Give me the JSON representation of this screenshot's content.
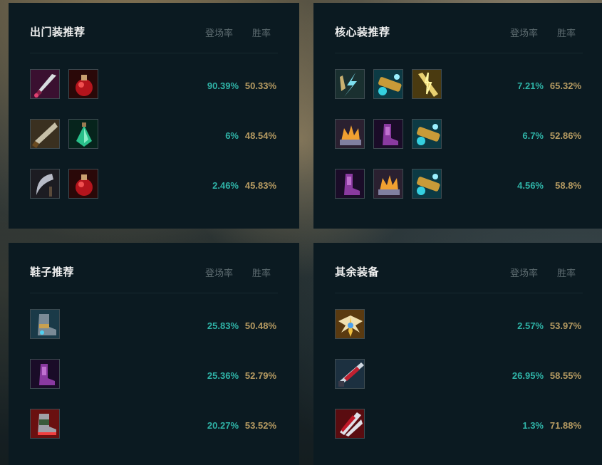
{
  "panels": [
    {
      "title": "出门装推荐",
      "col_rate": "登场率",
      "col_win": "胜率",
      "rows": [
        {
          "items": [
            "dagger-icon",
            "health-potion-icon"
          ],
          "rate": "90.39%",
          "win": "50.33%"
        },
        {
          "items": [
            "broadsword-icon",
            "refillable-potion-icon"
          ],
          "rate": "6%",
          "win": "48.54%"
        },
        {
          "items": [
            "sickle-icon",
            "health-potion-icon"
          ],
          "rate": "2.46%",
          "win": "45.83%"
        }
      ]
    },
    {
      "title": "核心装推荐",
      "col_rate": "登场率",
      "col_win": "胜率",
      "rows": [
        {
          "items": [
            "lightning-claw-icon",
            "cannon-icon",
            "zap-blade-icon"
          ],
          "rate": "7.21%",
          "win": "65.32%"
        },
        {
          "items": [
            "flame-crown-icon",
            "purple-boots-icon",
            "cannon-icon"
          ],
          "rate": "6.7%",
          "win": "52.86%"
        },
        {
          "items": [
            "purple-boots-icon",
            "flame-crown-icon",
            "cannon-icon"
          ],
          "rate": "4.56%",
          "win": "58.8%"
        }
      ]
    },
    {
      "title": "鞋子推荐",
      "col_rate": "登场率",
      "col_win": "胜率",
      "rows": [
        {
          "items": [
            "armored-boots-icon"
          ],
          "rate": "25.83%",
          "win": "50.48%"
        },
        {
          "items": [
            "purple-boots-icon"
          ],
          "rate": "25.36%",
          "win": "52.79%"
        },
        {
          "items": [
            "red-boots-icon"
          ],
          "rate": "20.27%",
          "win": "53.52%"
        }
      ]
    },
    {
      "title": "其余装备",
      "col_rate": "登场率",
      "col_win": "胜率",
      "rows": [
        {
          "items": [
            "angel-wings-icon"
          ],
          "rate": "2.57%",
          "win": "53.97%"
        },
        {
          "items": [
            "red-blade-icon"
          ],
          "rate": "26.95%",
          "win": "58.55%"
        },
        {
          "items": [
            "striped-claw-icon"
          ],
          "rate": "1.3%",
          "win": "71.88%"
        }
      ]
    }
  ]
}
